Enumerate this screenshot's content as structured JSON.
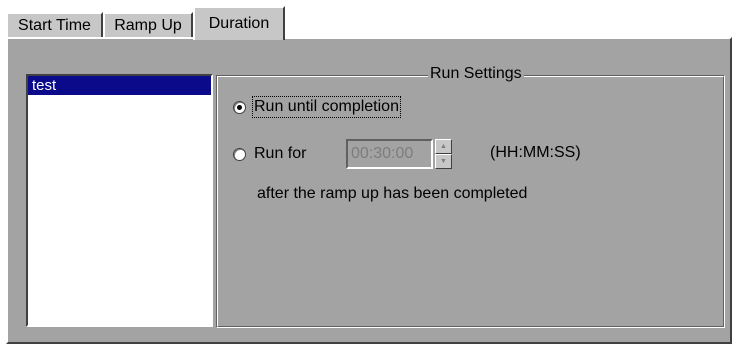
{
  "tabs": [
    {
      "label": "Start Time",
      "active": false
    },
    {
      "label": "Ramp Up",
      "active": false
    },
    {
      "label": "Duration",
      "active": true
    }
  ],
  "list": {
    "items": [
      {
        "label": "test",
        "selected": true
      }
    ]
  },
  "run_settings": {
    "title": "Run Settings",
    "option_completion": {
      "label": "Run until completion",
      "checked": true
    },
    "option_run_for": {
      "label": "Run for",
      "checked": false
    },
    "duration_value": "00:30:00",
    "duration_format": "(HH:MM:SS)",
    "after_text": "after the ramp up has been completed"
  },
  "colors": {
    "panel_bg": "#a3a3a3",
    "tab_bg": "#c7c7c7",
    "selection": "#0a0a8a"
  },
  "icons": {
    "spin_up": "spin-up-icon",
    "spin_down": "spin-down-icon"
  }
}
